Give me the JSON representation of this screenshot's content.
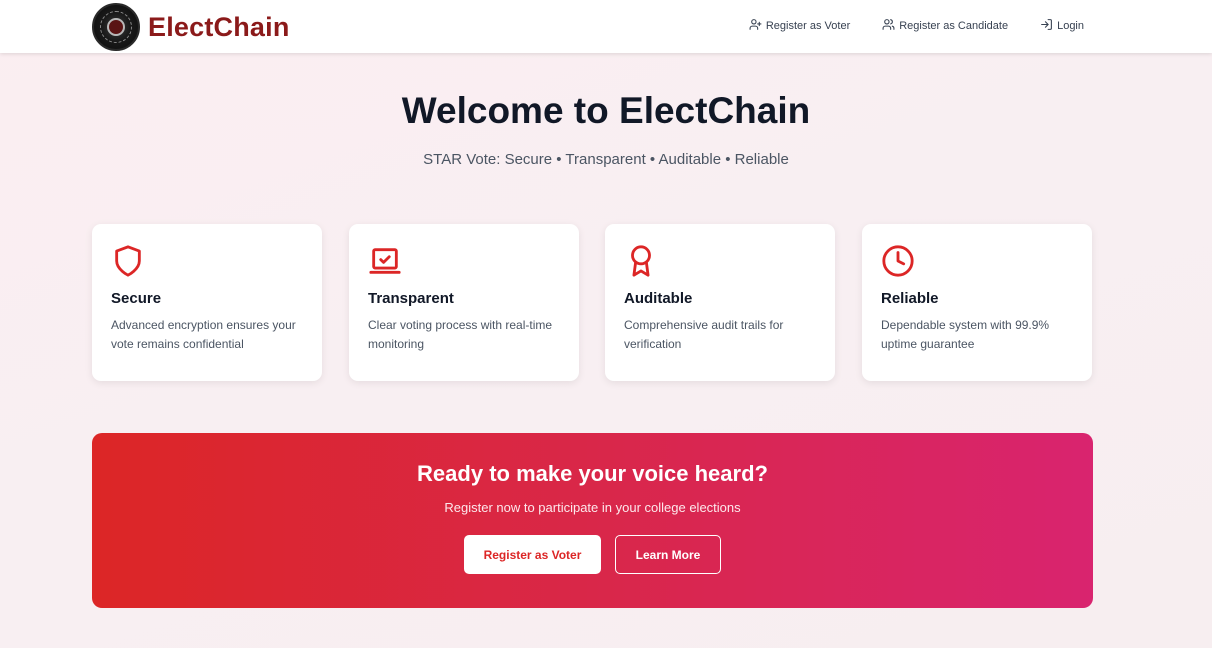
{
  "brand": {
    "name": "ElectChain",
    "logo_icon": "seal-logo-icon",
    "color": "#8b1a1a"
  },
  "nav": {
    "items": [
      {
        "label": "Register as Voter",
        "icon": "user-plus-icon"
      },
      {
        "label": "Register as Candidate",
        "icon": "users-icon"
      },
      {
        "label": "Login",
        "icon": "login-icon"
      }
    ]
  },
  "hero": {
    "title": "Welcome to ElectChain",
    "subtitle": "STAR Vote: Secure • Transparent • Auditable • Reliable"
  },
  "features": [
    {
      "title": "Secure",
      "description": "Advanced encryption ensures your vote remains confidential",
      "icon": "shield-icon"
    },
    {
      "title": "Transparent",
      "description": "Clear voting process with real-time monitoring",
      "icon": "monitor-check-icon"
    },
    {
      "title": "Auditable",
      "description": "Comprehensive audit trails for verification",
      "icon": "award-icon"
    },
    {
      "title": "Reliable",
      "description": "Dependable system with 99.9% uptime guarantee",
      "icon": "clock-icon"
    }
  ],
  "cta": {
    "title": "Ready to make your voice heard?",
    "subtitle": "Register now to participate in your college elections",
    "primary_label": "Register as Voter",
    "secondary_label": "Learn More"
  },
  "colors": {
    "accent": "#dc2626",
    "gradient_end": "#d9246f"
  }
}
